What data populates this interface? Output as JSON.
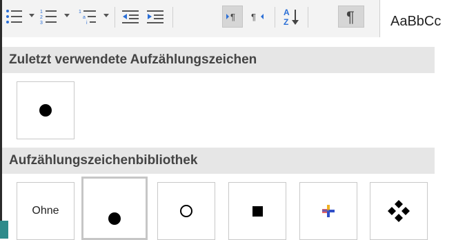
{
  "ribbon": {
    "buttons": [
      {
        "name": "bullets-button",
        "icon": "bullet-list-icon",
        "pressed": false
      },
      {
        "name": "numbering-button",
        "icon": "numbered-list-icon",
        "pressed": false
      },
      {
        "name": "multilevel-list-button",
        "icon": "multilevel-list-icon",
        "pressed": false
      },
      {
        "name": "decrease-indent-button",
        "icon": "decrease-indent-icon",
        "pressed": false
      },
      {
        "name": "increase-indent-button",
        "icon": "increase-indent-icon",
        "pressed": false
      },
      {
        "name": "ltr-button",
        "icon": "left-to-right-icon",
        "pressed": true
      },
      {
        "name": "rtl-button",
        "icon": "right-to-left-icon",
        "pressed": false
      },
      {
        "name": "sort-button",
        "icon": "sort-az-icon",
        "pressed": false
      },
      {
        "name": "show-formatting-button",
        "icon": "pilcrow-icon",
        "pressed": true
      }
    ],
    "styles_preview": "AaBbCc"
  },
  "recent": {
    "title": "Zuletzt verwendete Aufzählungszeichen",
    "tiles": [
      {
        "kind": "bullet-filled"
      }
    ]
  },
  "library": {
    "title": "Aufzählungszeichenbibliothek",
    "tiles": [
      {
        "kind": "none",
        "label": "Ohne"
      },
      {
        "kind": "bullet-filled",
        "selected": true
      },
      {
        "kind": "bullet-open"
      },
      {
        "kind": "bullet-square"
      },
      {
        "kind": "picture-plus"
      },
      {
        "kind": "diamond-cluster"
      }
    ]
  },
  "colors": {
    "accent_blue": "#2b6fd6",
    "header_bg": "#e6e6e6",
    "teal": "#2e8b8b"
  }
}
